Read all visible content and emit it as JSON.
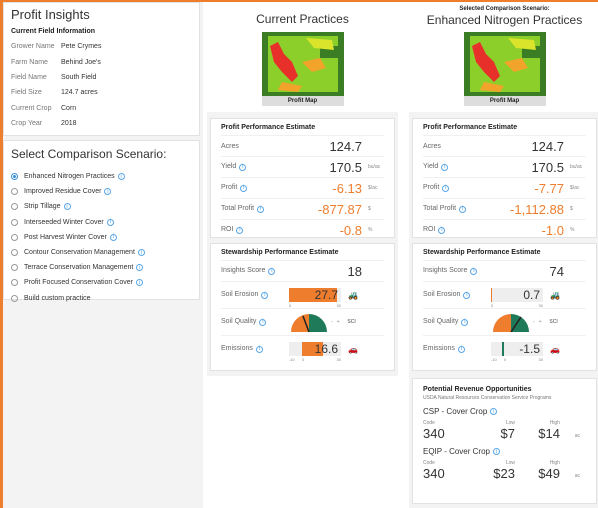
{
  "insights": {
    "title": "Profit Insights",
    "section": "Current Field Information",
    "fields": [
      {
        "label": "Grower Name",
        "value": "Pete Crymes"
      },
      {
        "label": "Farm Name",
        "value": "Behind Joe's"
      },
      {
        "label": "Field Name",
        "value": "South Field"
      },
      {
        "label": "Field Size",
        "value": "124.7 acres"
      },
      {
        "label": "Current Crop",
        "value": "Corn"
      },
      {
        "label": "Crop Year",
        "value": "2018"
      }
    ]
  },
  "scenario": {
    "title": "Select Comparison Scenario:",
    "selected_index": 0,
    "options": [
      {
        "label": "Enhanced Nitrogen Practices",
        "info": true
      },
      {
        "label": "Improved Residue Cover",
        "info": true
      },
      {
        "label": "Strip Tillage",
        "info": true
      },
      {
        "label": "Interseeded Winter Cover",
        "info": true
      },
      {
        "label": "Post Harvest Winter Cover",
        "info": true
      },
      {
        "label": "Contour Conservation Management",
        "info": true
      },
      {
        "label": "Terrace Conservation Management",
        "info": true
      },
      {
        "label": "Profit Focused Conservation Cover",
        "info": true
      },
      {
        "label": "Build custom practice",
        "info": false
      }
    ]
  },
  "current": {
    "title": "Current Practices",
    "map_label": "Profit Map",
    "profit_title": "Profit Performance Estimate",
    "acres_label": "Acres",
    "acres": "124.7",
    "yield_label": "Yield",
    "yield": "170.5",
    "yield_unit": "bu/ac",
    "profit_label": "Profit",
    "profit": "-6.13",
    "profit_unit": "$/ac",
    "total_label": "Total Profit",
    "total": "-877.87",
    "total_unit": "$",
    "roi_label": "ROI",
    "roi": "-0.8",
    "roi_unit": "%",
    "steward_title": "Stewardship Performance Estimate",
    "score_label": "Insights Score",
    "score": "18",
    "erosion_label": "Soil Erosion",
    "erosion": "27.7",
    "erosion_fraction": 0.92,
    "erosion_min": "0",
    "erosion_max": "30",
    "quality_label": "Soil Quality",
    "quality_unit": "SCI",
    "quality_min": "-",
    "quality_max": "+",
    "emissions_label": "Emissions",
    "emissions": "16.6",
    "emissions_min": "-10",
    "emissions_zero": "0",
    "emissions_max": "30"
  },
  "comparison": {
    "subtitle": "Selected Comparison Scenario:",
    "title": "Enhanced Nitrogen Practices",
    "map_label": "Profit Map",
    "profit_title": "Profit Performance Estimate",
    "acres_label": "Acres",
    "acres": "124.7",
    "yield_label": "Yield",
    "yield": "170.5",
    "yield_unit": "bu/ac",
    "profit_label": "Profit",
    "profit": "-7.77",
    "profit_unit": "$/ac",
    "total_label": "Total Profit",
    "total": "-1,112.88",
    "total_unit": "$",
    "roi_label": "ROI",
    "roi": "-1.0",
    "roi_unit": "%",
    "steward_title": "Stewardship Performance Estimate",
    "score_label": "Insights Score",
    "score": "74",
    "erosion_label": "Soil Erosion",
    "erosion": "0.7",
    "erosion_fraction": 0.02,
    "erosion_min": "0",
    "erosion_max": "30",
    "quality_label": "Soil Quality",
    "quality_unit": "SCI",
    "quality_min": "-",
    "quality_max": "+",
    "emissions_label": "Emissions",
    "emissions": "-1.5",
    "emissions_min": "-10",
    "emissions_zero": "0",
    "emissions_max": "30"
  },
  "opportunities": {
    "title": "Potential Revenue Opportunities",
    "note": "USDA Natural Resources Conservation Service Programs",
    "code_label": "Code",
    "low_label": "Low",
    "high_label": "High",
    "unit": "ac",
    "programs": [
      {
        "name": "CSP - Cover Crop",
        "code": "340",
        "low": "$7",
        "high": "$14"
      },
      {
        "name": "EQIP - Cover Crop",
        "code": "340",
        "low": "$23",
        "high": "$49"
      }
    ]
  },
  "colors": {
    "accent": "#ee7d2e",
    "info": "#5aa6e8",
    "gauge_green": "#1f7a5a"
  }
}
